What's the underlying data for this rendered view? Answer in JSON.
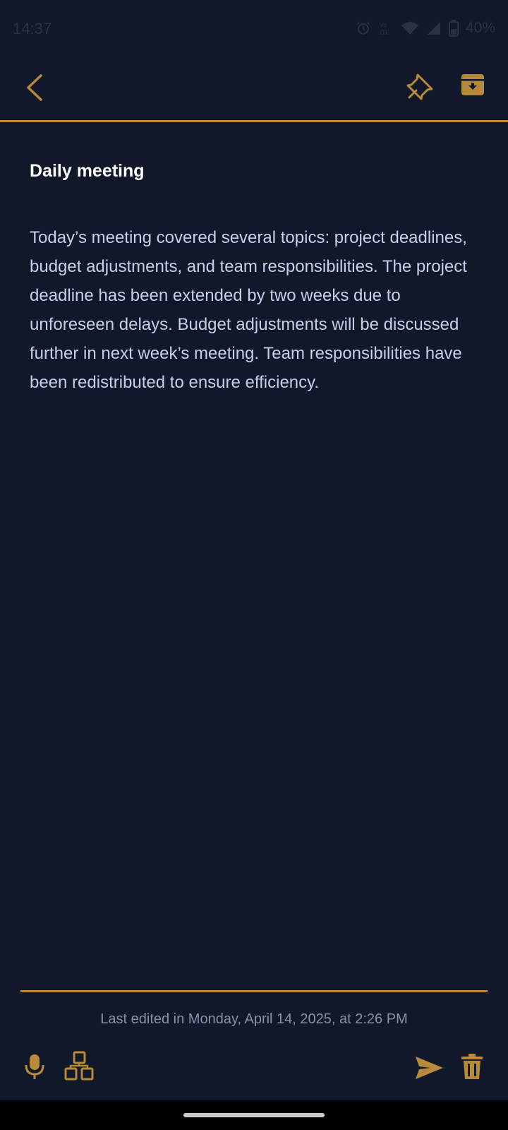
{
  "status_bar": {
    "time": "14:37",
    "battery": "40%",
    "icons": [
      "alarm-icon",
      "volte-icon",
      "wifi-icon",
      "signal-icon",
      "battery-icon"
    ]
  },
  "toolbar": {
    "back_icon": "chevron-left-icon",
    "pin_icon": "pin-icon",
    "archive_icon": "archive-icon"
  },
  "note": {
    "title": "Daily meeting",
    "body": "Today’s meeting covered several topics: project deadlines, budget adjustments, and team responsibilities. The project deadline has been extended by two weeks due to unforeseen delays. Budget adjustments will be discussed further in next week’s meeting. Team responsibilities have been redistributed to ensure efficiency."
  },
  "footer": {
    "last_edited": "Last edited in Monday, April 14, 2025, at 2:26 PM",
    "icons": [
      "mic-icon",
      "layout-icon",
      "send-icon",
      "trash-icon"
    ]
  },
  "colors": {
    "background": "#10182a",
    "accent": "#b68a3a",
    "title": "#ffffff",
    "body_text": "#c5d0ea",
    "muted_text": "#8791a6"
  }
}
